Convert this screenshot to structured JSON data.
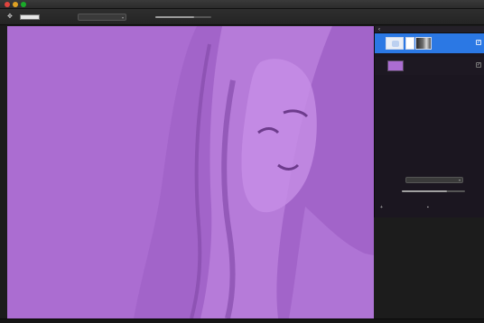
{
  "window": {
    "title": "",
    "traffic": {
      "close": "#e0443e",
      "minimize": "#dea123",
      "maximize": "#1aab29"
    }
  },
  "toolbar": {
    "tool_icon": "move-tool-icon",
    "mode_label": "",
    "mode_value": "",
    "brush_label": "",
    "brush_value": "",
    "opacity_fraction": 0.7
  },
  "canvas": {
    "tint": "#ab6dd1",
    "shade": "#9a5cc2",
    "highlight": "#c78ee6"
  },
  "panel": {
    "title": "",
    "back_icon": "back-arrow-icon",
    "layers": [
      {
        "label": "",
        "selected": true,
        "visible": true
      },
      {
        "label": "",
        "selected": false,
        "visible": true,
        "color": "#ab6dd1"
      }
    ],
    "blend_label": "",
    "blend_value": "",
    "opacity_label": "",
    "opacity_value": "",
    "opacity_fraction": 0.72,
    "add_button": "",
    "delete_button": ""
  },
  "accent": "#2b78e4"
}
